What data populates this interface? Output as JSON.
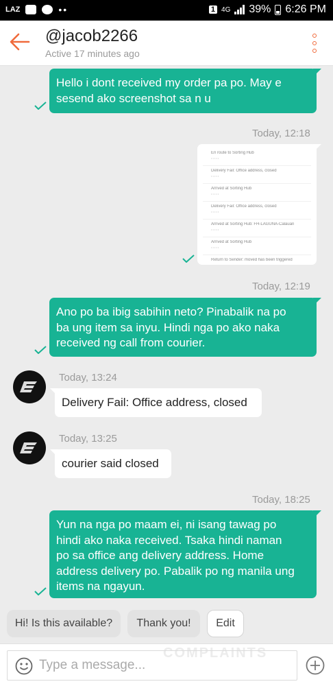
{
  "status_bar": {
    "app_badge": "LAZ",
    "sim_slot": "1",
    "network": "4G",
    "battery": "39%",
    "time": "6:26 PM"
  },
  "header": {
    "title": "@jacob2266",
    "subtitle": "Active 17 minutes ago"
  },
  "messages": [
    {
      "direction": "out",
      "lines": [
        "Hello i dont received my order pa po. May e",
        "sesend ako screenshot sa n u"
      ]
    },
    {
      "direction": "out",
      "type": "image",
      "time": "Today, 12:18",
      "tracking": [
        "En route to Sorting Hub",
        "Delivery Fail: Office address, closed",
        "Arrived at Sorting Hub",
        "Delivery Fail: Office address, closed",
        "Arrived at Sorting Hub: FH-LAGUNA-Calauan",
        "Arrived at Sorting Hub",
        "Return to Sender: moved has been triggered"
      ]
    },
    {
      "direction": "out",
      "time": "Today, 12:19",
      "lines": [
        "Ano po ba ibig sabihin neto? Pinabalik na po",
        "ba ung item sa inyu. Hindi nga po ako naka",
        "received ng call from courier."
      ]
    },
    {
      "direction": "in",
      "time": "Today, 13:24",
      "lines": [
        "Delivery Fail: Office address, closed"
      ]
    },
    {
      "direction": "in",
      "time": "Today, 13:25",
      "lines": [
        "courier said closed"
      ]
    },
    {
      "direction": "out",
      "time": "Today, 18:25",
      "lines": [
        "Yun na nga po maam ei, ni isang tawag po",
        "hindi ako naka received. Tsaka hindi naman",
        "po sa office ang delivery address. Home",
        "address delivery po. Pabalik po ng manila ung",
        "items na ngayun."
      ]
    }
  ],
  "quick_replies": [
    "Hi! Is this available?",
    "Thank you!",
    "Edit"
  ],
  "input": {
    "placeholder": "Type a message..."
  },
  "watermark": "COMPLAINTS",
  "colors": {
    "accent": "#f06a3b",
    "outgoing": "#18b394",
    "background": "#ececec"
  },
  "icons": [
    "back-arrow-icon",
    "more-vert-icon",
    "check-icon",
    "avatar-logo-icon",
    "emoji-icon",
    "plus-icon"
  ]
}
